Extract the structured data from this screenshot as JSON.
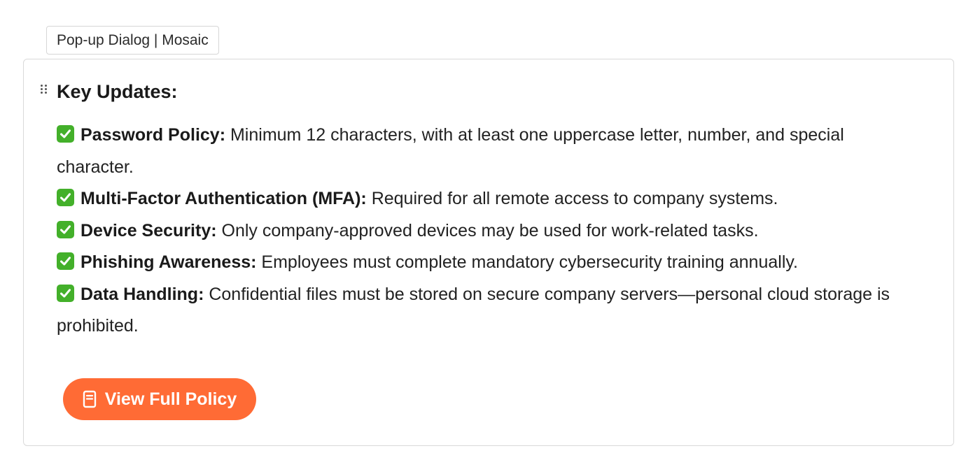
{
  "window": {
    "tag_label": "Pop-up Dialog | Mosaic"
  },
  "panel": {
    "heading": "Key Updates:",
    "items": [
      {
        "label": "Password Policy:",
        "text": " Minimum 12 characters, with at least one uppercase letter, number, and special character."
      },
      {
        "label": "Multi-Factor Authentication (MFA):",
        "text": " Required for all remote access to company systems."
      },
      {
        "label": "Device Security:",
        "text": " Only company-approved devices may be used for work-related tasks."
      },
      {
        "label": "Phishing Awareness:",
        "text": " Employees must complete mandatory cybersecurity training annually."
      },
      {
        "label": "Data Handling:",
        "text": " Confidential files must be stored on secure company servers—personal cloud storage is prohibited."
      }
    ],
    "item_icon": "check-mark-icon",
    "button": {
      "label": "View Full Policy",
      "icon": "document-icon"
    }
  },
  "colors": {
    "accent": "#ff6b35",
    "check": "#43b02a"
  }
}
